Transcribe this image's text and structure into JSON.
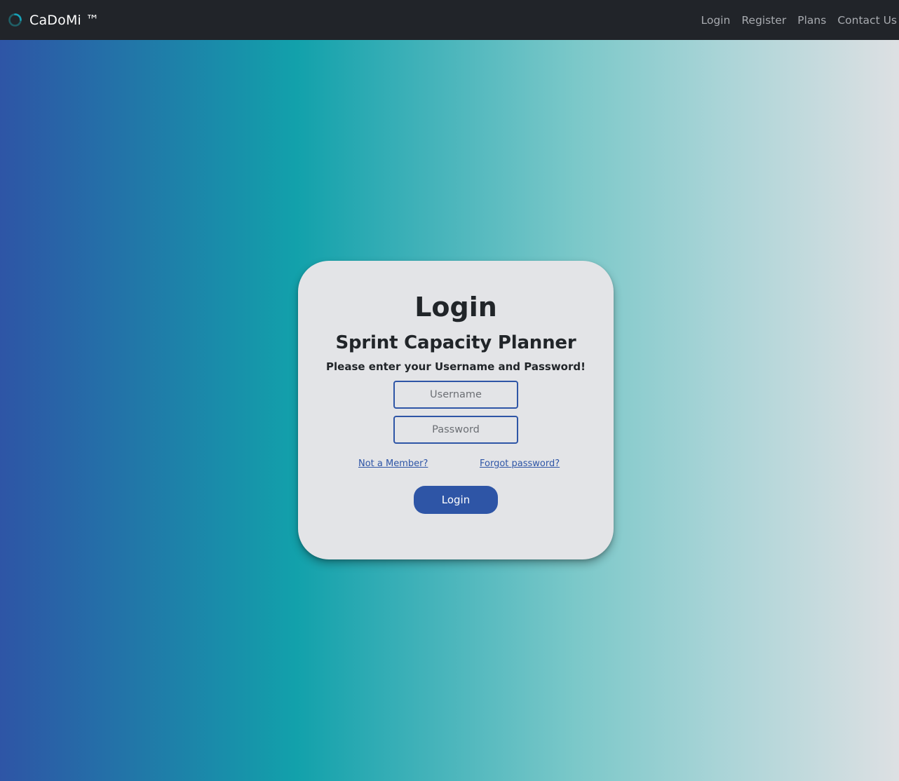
{
  "navbar": {
    "brand_text": "CaDoMi ™",
    "brand_icon": "spinner-ring-icon",
    "links": [
      {
        "label": "Login"
      },
      {
        "label": "Register"
      },
      {
        "label": "Plans"
      },
      {
        "label": "Contact Us"
      }
    ]
  },
  "login_card": {
    "title": "Login",
    "subtitle": "Sprint Capacity Planner",
    "instruction": "Please enter your Username and Password!",
    "username_placeholder": "Username",
    "password_placeholder": "Password",
    "not_member_link": "Not a Member?",
    "forgot_password_link": "Forgot password?",
    "login_button_label": "Login"
  },
  "colors": {
    "navbar_bg": "#212429",
    "accent": "#2e55a6",
    "card_bg": "#e3e4e7",
    "gradient_start": "#2e55a6",
    "gradient_mid": "#12a1ab",
    "gradient_end": "#dde0e3"
  }
}
